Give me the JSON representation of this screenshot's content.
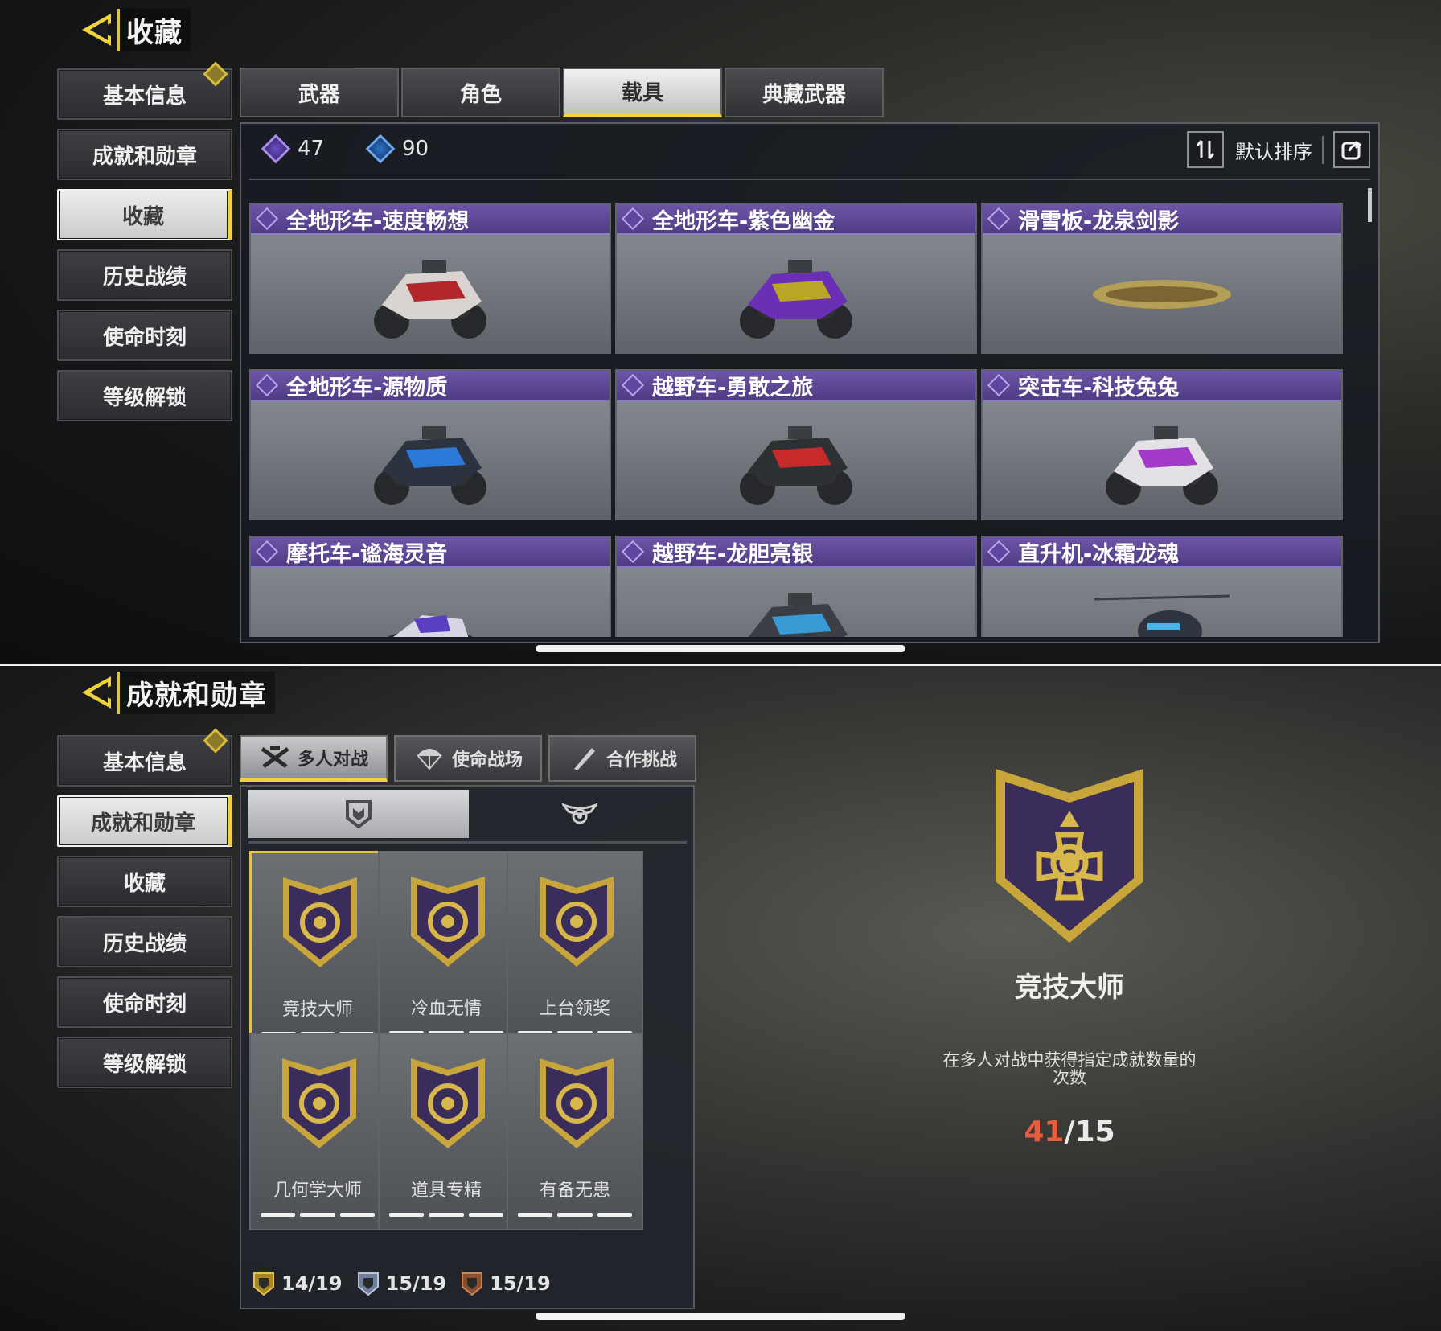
{
  "top": {
    "title": "收藏",
    "side_menu": [
      "基本信息",
      "成就和勋章",
      "收藏",
      "历史战绩",
      "使命时刻",
      "等级解锁"
    ],
    "tabs": [
      "武器",
      "角色",
      "载具",
      "典藏武器"
    ],
    "currency": [
      {
        "icon": "purple-gem-icon",
        "value": "47"
      },
      {
        "icon": "blue-gem-icon",
        "value": "90"
      }
    ],
    "sort_label": "默认排序",
    "items": [
      {
        "name": "全地形车-速度畅想",
        "colors": [
          "#d9d4cf",
          "#b3262a"
        ]
      },
      {
        "name": "全地形车-紫色幽金",
        "colors": [
          "#6a2fb5",
          "#b9a526"
        ]
      },
      {
        "name": "滑雪板-龙泉剑影",
        "colors": [
          "#b59e55",
          "#7a6533"
        ]
      },
      {
        "name": "全地形车-源物质",
        "colors": [
          "#2b3340",
          "#2a78d8"
        ]
      },
      {
        "name": "越野车-勇敢之旅",
        "colors": [
          "#2e3134",
          "#c62a2a"
        ]
      },
      {
        "name": "突击车-科技兔兔",
        "colors": [
          "#e3e1e6",
          "#a239c9"
        ]
      },
      {
        "name": "摩托车-谧海灵音",
        "colors": [
          "#d8d6e4",
          "#5a3fc1"
        ]
      },
      {
        "name": "越野车-龙胆亮银",
        "colors": [
          "#3b3e44",
          "#3a9ad6"
        ]
      },
      {
        "name": "直升机-冰霜龙魂",
        "colors": [
          "#2f3540",
          "#49b5e6"
        ]
      }
    ]
  },
  "bottom": {
    "title": "成就和勋章",
    "side_menu": [
      "基本信息",
      "成就和勋章",
      "收藏",
      "历史战绩",
      "使命时刻",
      "等级解锁"
    ],
    "tabs": [
      "多人对战",
      "使命战场",
      "合作挑战"
    ],
    "medals": [
      {
        "name": "竞技大师",
        "icon": "medal-cross-icon"
      },
      {
        "name": "冷血无情",
        "icon": "medal-dragon-icon"
      },
      {
        "name": "上台领奖",
        "icon": "medal-trophy-icon"
      },
      {
        "name": "几何学大师",
        "icon": "medal-grenade-icon"
      },
      {
        "name": "道具专精",
        "icon": "medal-boom-icon"
      },
      {
        "name": "有备无患",
        "icon": "medal-tools-icon"
      }
    ],
    "stats": [
      {
        "icon": "gold-shield-icon",
        "value": "14/19"
      },
      {
        "icon": "silver-shield-icon",
        "value": "15/19"
      },
      {
        "icon": "bronze-shield-icon",
        "value": "15/19"
      }
    ],
    "detail": {
      "title": "竞技大师",
      "description": "在多人对战中获得指定成就数量的次数",
      "progress_current": "41",
      "progress_total": "/15"
    }
  },
  "colors": {
    "accent": "#f0d23c",
    "rarity_purple": "#5f48a0",
    "progress_current": "#ec5b3a"
  }
}
